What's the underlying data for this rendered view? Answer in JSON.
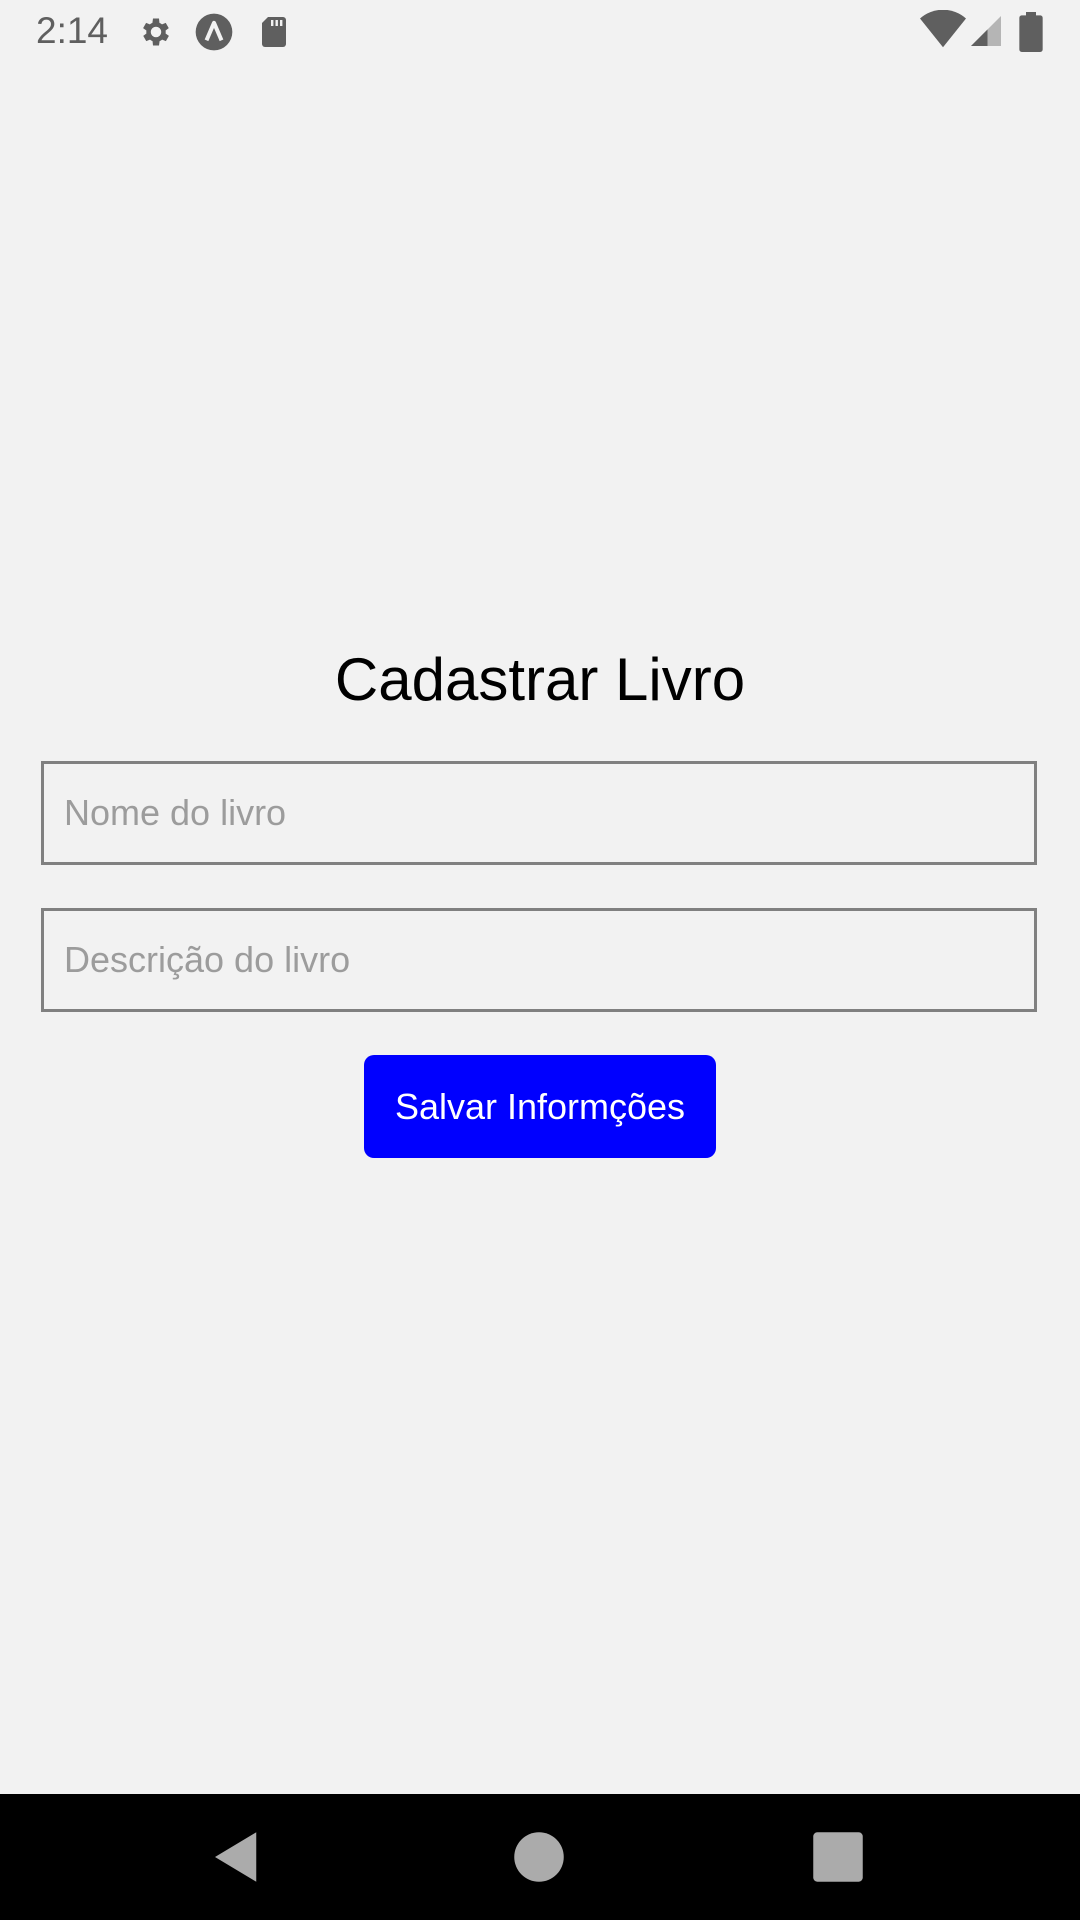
{
  "status_bar": {
    "time": "2:14",
    "left_icons": [
      "gear-icon",
      "a-circle-icon",
      "sd-card-icon"
    ],
    "right_icons": [
      "wifi-icon",
      "signal-icon",
      "battery-icon"
    ]
  },
  "form": {
    "title": "Cadastrar Livro",
    "name_placeholder": "Nome do livro",
    "name_value": "",
    "description_placeholder": "Descrição do livro",
    "description_value": "",
    "save_label": "Salvar Informções"
  },
  "colors": {
    "background": "#f2f2f2",
    "button": "#0000ff",
    "button_text": "#ffffff",
    "field_border": "#808080",
    "placeholder": "#9c9c9c",
    "nav_bar": "#000000"
  },
  "nav_bar": {
    "buttons": [
      "back-icon",
      "home-icon",
      "recents-icon"
    ]
  }
}
